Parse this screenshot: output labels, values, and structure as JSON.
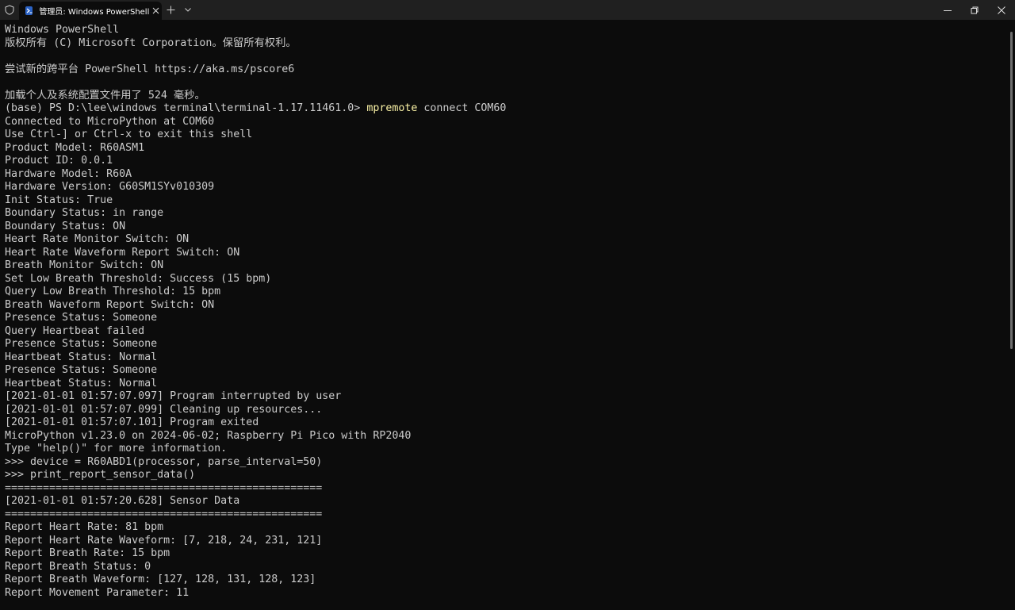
{
  "window": {
    "tab_title": "管理员: Windows PowerShell",
    "tab_icon": "powershell-icon"
  },
  "terminal": {
    "lines": [
      "Windows PowerShell",
      "版权所有 (C) Microsoft Corporation。保留所有权利。",
      "",
      "尝试新的跨平台 PowerShell https://aka.ms/pscore6",
      "",
      "加载个人及系统配置文件用了 524 毫秒。",
      {
        "prompt": "(base) PS D:\\lee\\windows terminal\\terminal-1.17.11461.0> ",
        "command": "mpremote",
        "args": " connect COM60"
      },
      "Connected to MicroPython at COM60",
      "Use Ctrl-] or Ctrl-x to exit this shell",
      "Product Model: R60ASM1",
      "Product ID: 0.0.1",
      "Hardware Model: R60A",
      "Hardware Version: G60SM1SYv010309",
      "Init Status: True",
      "Boundary Status: in range",
      "Boundary Status: ON",
      "Heart Rate Monitor Switch: ON",
      "Heart Rate Waveform Report Switch: ON",
      "Breath Monitor Switch: ON",
      "Set Low Breath Threshold: Success (15 bpm)",
      "Query Low Breath Threshold: 15 bpm",
      "Breath Waveform Report Switch: ON",
      "Presence Status: Someone",
      "Query Heartbeat failed",
      "Presence Status: Someone",
      "Heartbeat Status: Normal",
      "Presence Status: Someone",
      "Heartbeat Status: Normal",
      "[2021-01-01 01:57:07.097] Program interrupted by user",
      "[2021-01-01 01:57:07.099] Cleaning up resources...",
      "[2021-01-01 01:57:07.101] Program exited",
      "MicroPython v1.23.0 on 2024-06-02; Raspberry Pi Pico with RP2040",
      "Type \"help()\" for more information.",
      ">>> device = R60ABD1(processor, parse_interval=50)",
      ">>> print_report_sensor_data()",
      "==================================================",
      "[2021-01-01 01:57:20.628] Sensor Data",
      "==================================================",
      "Report Heart Rate: 81 bpm",
      "Report Heart Rate Waveform: [7, 218, 24, 231, 121]",
      "Report Breath Rate: 15 bpm",
      "Report Breath Status: 0",
      "Report Breath Waveform: [127, 128, 131, 128, 123]",
      "Report Movement Parameter: 11"
    ]
  }
}
